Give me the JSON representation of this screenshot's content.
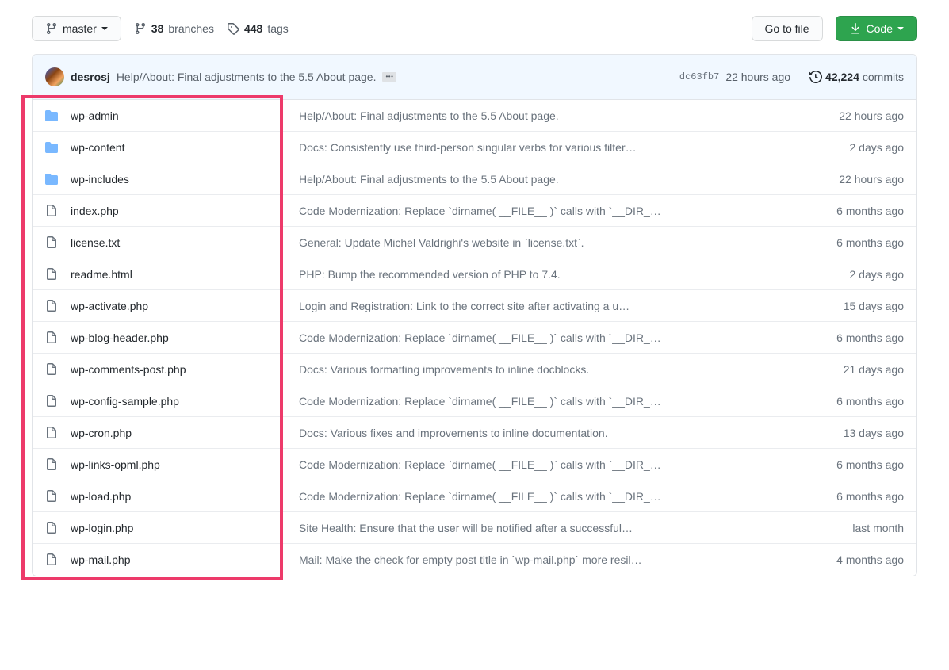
{
  "toolbar": {
    "branch_label": "master",
    "branches_count": "38",
    "branches_label": "branches",
    "tags_count": "448",
    "tags_label": "tags",
    "goto_file_label": "Go to file",
    "code_label": "Code"
  },
  "commit_bar": {
    "author": "desrosj",
    "message": "Help/About: Final adjustments to the 5.5 About page.",
    "sha": "dc63fb7",
    "time": "22 hours ago",
    "commits_count": "42,224",
    "commits_label": "commits"
  },
  "files": [
    {
      "type": "dir",
      "name": "wp-admin",
      "msg": "Help/About: Final adjustments to the 5.5 About page.",
      "age": "22 hours ago"
    },
    {
      "type": "dir",
      "name": "wp-content",
      "msg": "Docs: Consistently use third-person singular verbs for various filter…",
      "age": "2 days ago"
    },
    {
      "type": "dir",
      "name": "wp-includes",
      "msg": "Help/About: Final adjustments to the 5.5 About page.",
      "age": "22 hours ago"
    },
    {
      "type": "file",
      "name": "index.php",
      "msg": "Code Modernization: Replace `dirname( __FILE__ )` calls with `__DIR_…",
      "age": "6 months ago"
    },
    {
      "type": "file",
      "name": "license.txt",
      "msg": "General: Update Michel Valdrighi's website in `license.txt`.",
      "age": "6 months ago"
    },
    {
      "type": "file",
      "name": "readme.html",
      "msg": "PHP: Bump the recommended version of PHP to 7.4.",
      "age": "2 days ago"
    },
    {
      "type": "file",
      "name": "wp-activate.php",
      "msg": "Login and Registration: Link to the correct site after activating a u…",
      "age": "15 days ago"
    },
    {
      "type": "file",
      "name": "wp-blog-header.php",
      "msg": "Code Modernization: Replace `dirname( __FILE__ )` calls with `__DIR_…",
      "age": "6 months ago"
    },
    {
      "type": "file",
      "name": "wp-comments-post.php",
      "msg": "Docs: Various formatting improvements to inline docblocks.",
      "age": "21 days ago"
    },
    {
      "type": "file",
      "name": "wp-config-sample.php",
      "msg": "Code Modernization: Replace `dirname( __FILE__ )` calls with `__DIR_…",
      "age": "6 months ago"
    },
    {
      "type": "file",
      "name": "wp-cron.php",
      "msg": "Docs: Various fixes and improvements to inline documentation.",
      "age": "13 days ago"
    },
    {
      "type": "file",
      "name": "wp-links-opml.php",
      "msg": "Code Modernization: Replace `dirname( __FILE__ )` calls with `__DIR_…",
      "age": "6 months ago"
    },
    {
      "type": "file",
      "name": "wp-load.php",
      "msg": "Code Modernization: Replace `dirname( __FILE__ )` calls with `__DIR_…",
      "age": "6 months ago"
    },
    {
      "type": "file",
      "name": "wp-login.php",
      "msg": "Site Health: Ensure that the user will be notified after a successful…",
      "age": "last month"
    },
    {
      "type": "file",
      "name": "wp-mail.php",
      "msg": "Mail: Make the check for empty post title in `wp-mail.php` more resil…",
      "age": "4 months ago"
    }
  ]
}
